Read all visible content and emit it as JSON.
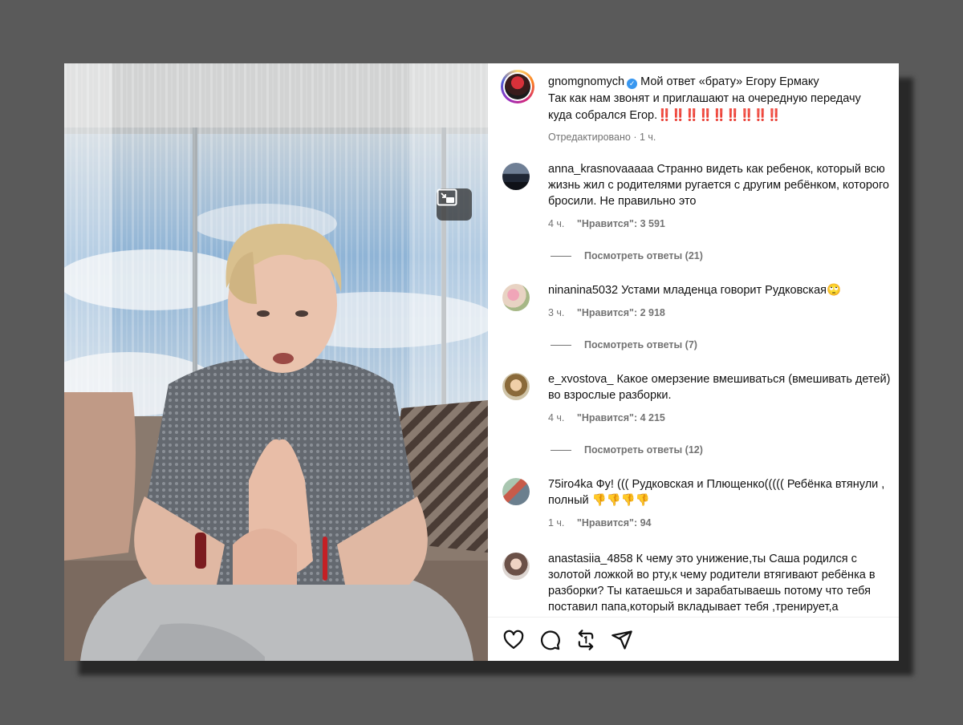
{
  "post": {
    "username": "gnomgnomych",
    "caption_line1": "Мой ответ «брату» Егору Ермаку",
    "caption_line2": "Так как нам звонят и приглашают на очередную передачу куда собрался Егор.",
    "caption_exclaims": "‼️‼️‼️‼️‼️‼️‼️‼️‼️",
    "edited_label": "Отредактировано",
    "time": "1 ч."
  },
  "comments": [
    {
      "username": "anna_krasnovaaaaa",
      "text": "Странно видеть как ребенок, который всю жизнь жил с родителями ругается с другим ребёнком, которого бросили. Не правильно это",
      "age": "4 ч.",
      "likes": "\"Нравится\": 3 591",
      "replies": "Посмотреть ответы (21)"
    },
    {
      "username": "ninanina5032",
      "text": "Устами младенца говорит Рудковская🙄",
      "age": "3 ч.",
      "likes": "\"Нравится\": 2 918",
      "replies": "Посмотреть ответы (7)"
    },
    {
      "username": "e_xvostova_",
      "text": "Какое омерзение вмешиваться (вмешивать детей) во взрослые разборки.",
      "age": "4 ч.",
      "likes": "\"Нравится\": 4 215",
      "replies": "Посмотреть ответы (12)"
    },
    {
      "username": "75iro4ka",
      "text": "Фу! ((( Рудковская и Плющенко((((( Ребёнка втянули , полный 👎👎👎👎",
      "age": "1 ч.",
      "likes": "\"Нравится\": 94",
      "replies": ""
    },
    {
      "username": "anastasiia_4858",
      "text": "К чему это унижение,ты Саша родился с золотой ложкой во рту,к чему родители втягивают ребёнка в разборки? Ты катаешься и зарабатываешь потому что тебя поставил папа,который вкладывает тебя ,тренирует,а",
      "age": "",
      "likes": "",
      "replies": ""
    }
  ],
  "icons": [
    "picture-in-picture-icon",
    "heart-icon",
    "comment-icon",
    "repost-icon",
    "share-icon"
  ],
  "colors": {
    "verified": "#3897f0",
    "meta_gray": "#737373",
    "backdrop": "#5a5a5a"
  }
}
